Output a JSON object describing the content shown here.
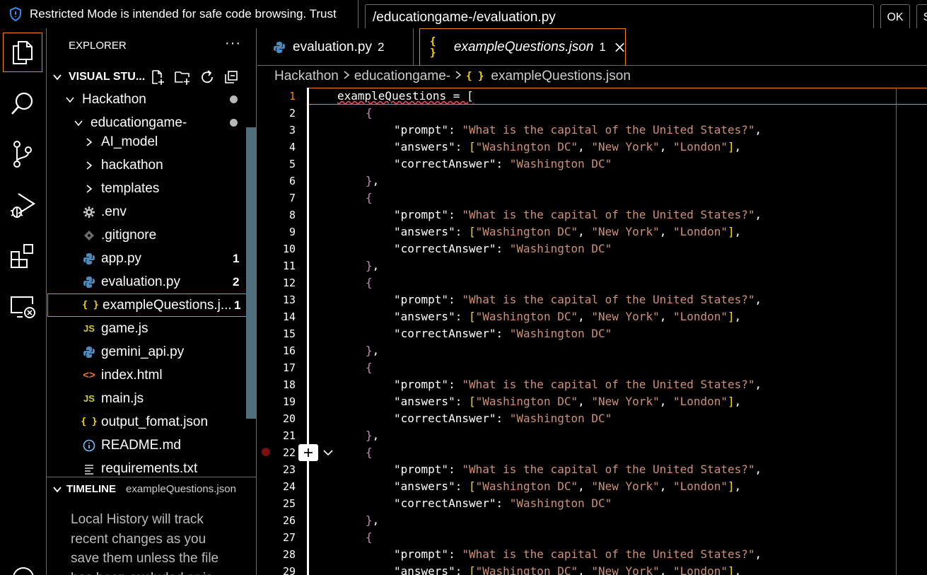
{
  "banner": {
    "text": "Restricted Mode is intended for safe code browsing. Trust"
  },
  "quick_input": {
    "value": "/educationgame-/evaluation.py",
    "ok_label": "OK",
    "second_label": "S"
  },
  "activity_bar": {
    "items": [
      {
        "name": "explorer-icon",
        "active": true
      },
      {
        "name": "search-icon"
      },
      {
        "name": "source-control-icon"
      },
      {
        "name": "run-debug-icon"
      },
      {
        "name": "extensions-icon"
      },
      {
        "name": "remote-explorer-icon"
      }
    ]
  },
  "sidebar": {
    "title": "EXPLORER",
    "more": "···",
    "workspace": "VISUAL STU...",
    "tree": [
      {
        "label": "Hackathon",
        "type": "folder-open"
      },
      {
        "label": "educationgame-",
        "type": "folder-open"
      },
      {
        "label": "AI_model",
        "type": "folder"
      },
      {
        "label": "hackathon",
        "type": "folder"
      },
      {
        "label": "templates",
        "type": "folder"
      },
      {
        "label": ".env",
        "type": "gear",
        "icon": "gear-icon"
      },
      {
        "label": ".gitignore",
        "type": "git",
        "icon": "git-icon"
      },
      {
        "label": "app.py",
        "type": "py",
        "badge": "1"
      },
      {
        "label": "evaluation.py",
        "type": "py",
        "badge": "2"
      },
      {
        "label": "exampleQuestions.j...",
        "type": "json",
        "badge": "1",
        "selected": true
      },
      {
        "label": "game.js",
        "type": "js"
      },
      {
        "label": "gemini_api.py",
        "type": "py"
      },
      {
        "label": "index.html",
        "type": "html"
      },
      {
        "label": "main.js",
        "type": "js"
      },
      {
        "label": "output_fomat.json",
        "type": "json"
      },
      {
        "label": "README.md",
        "type": "info"
      },
      {
        "label": "requirements.txt",
        "type": "txt"
      }
    ],
    "timeline": {
      "title": "TIMELINE",
      "file": "exampleQuestions.json",
      "body": "Local History will track recent changes as you save them unless the file has been excluded or is"
    }
  },
  "tabs": [
    {
      "label": "evaluation.py",
      "badge": "2",
      "icon": "python-icon"
    },
    {
      "label": "exampleQuestions.json",
      "badge": "1",
      "icon": "json-icon",
      "active": true
    }
  ],
  "breadcrumb": {
    "parts": [
      "Hackathon",
      "educationgame-",
      "exampleQuestions.json"
    ]
  },
  "editor": {
    "current_line": "1",
    "line_numbers": [
      "1",
      "2",
      "3",
      "4",
      "5",
      "6",
      "7",
      "8",
      "9",
      "10",
      "11",
      "12",
      "13",
      "14",
      "15",
      "16",
      "17",
      "18",
      "19",
      "20",
      "21",
      "22",
      "23",
      "24",
      "25",
      "26",
      "27",
      "28",
      "29"
    ],
    "strings": {
      "assign": "exampleQuestions = [",
      "prompt_key": "\"prompt\"",
      "prompt_val": "\"What is the capital of the United States?\"",
      "answers_key": "\"answers\"",
      "ans1": "\"Washington DC\"",
      "ans2": "\"New York\"",
      "ans3": "\"London\"",
      "correct_key": "\"correctAnswer\"",
      "correct_val": "\"Washington DC\""
    }
  },
  "colors": {
    "accent": "#f38518",
    "string": "#ce9178",
    "bracket1": "#c586c0",
    "bracket2": "#ffd700",
    "python": "#4b8bbe",
    "json": "#ffd700",
    "js": "#cbcb41",
    "html": "#e37933"
  }
}
